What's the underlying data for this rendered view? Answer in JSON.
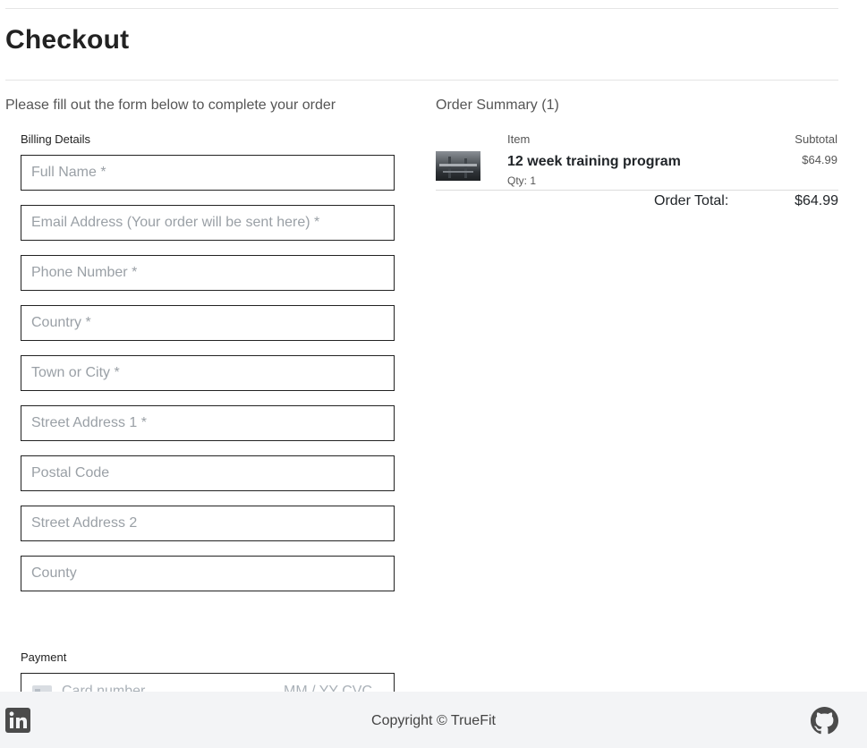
{
  "page": {
    "title": "Checkout",
    "intro": "Please fill out the form below to complete your order"
  },
  "billing": {
    "label": "Billing Details",
    "fields": [
      {
        "name": "full-name",
        "placeholder": "Full Name *",
        "value": ""
      },
      {
        "name": "email",
        "placeholder": "Email Address (Your order will be sent here) *",
        "value": ""
      },
      {
        "name": "phone",
        "placeholder": "Phone Number *",
        "value": ""
      },
      {
        "name": "country",
        "placeholder": "Country *",
        "value": ""
      },
      {
        "name": "town",
        "placeholder": "Town or City *",
        "value": ""
      },
      {
        "name": "street1",
        "placeholder": "Street Address 1 *",
        "value": ""
      },
      {
        "name": "postal",
        "placeholder": "Postal Code",
        "value": ""
      },
      {
        "name": "street2",
        "placeholder": "Street Address 2",
        "value": ""
      },
      {
        "name": "county",
        "placeholder": "County",
        "value": ""
      }
    ]
  },
  "payment": {
    "label": "Payment",
    "card_placeholder": "Card number",
    "exp_cvc_placeholder": "MM / YY  CVC",
    "icon": "credit-card-icon"
  },
  "summary": {
    "title": "Order Summary (1)",
    "col_item": "Item",
    "col_subtotal": "Subtotal",
    "items": [
      {
        "name": "12 week training program",
        "qty": "Qty: 1",
        "price": "$64.99",
        "image": "gym-equipment-thumbnail"
      }
    ],
    "total_label": "Order Total:",
    "total_value": "$64.99"
  },
  "footer": {
    "copyright": "Copyright © TrueFit",
    "left_icon": "linkedin-icon",
    "right_icon": "github-icon"
  },
  "colors": {
    "footer_bg": "#f3f4f6",
    "input_border": "#222222",
    "placeholder": "#9aa0a6"
  }
}
